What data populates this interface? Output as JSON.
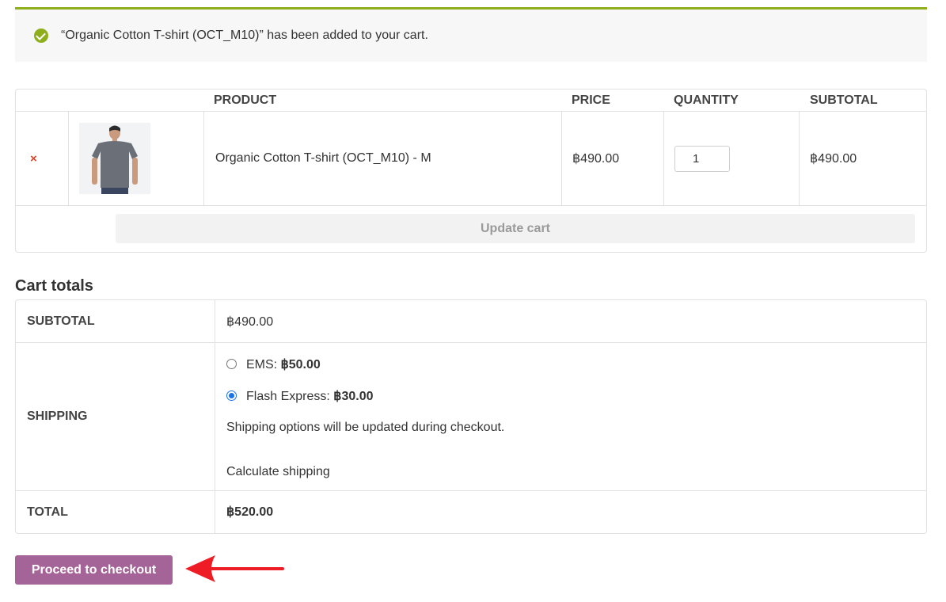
{
  "notice": {
    "message": "“Organic Cotton T-shirt (OCT_M10)” has been added to your cart."
  },
  "cart": {
    "headers": {
      "product": "PRODUCT",
      "price": "PRICE",
      "quantity": "QUANTITY",
      "subtotal": "SUBTOTAL"
    },
    "items": [
      {
        "remove": "×",
        "name": "Organic Cotton T-shirt (OCT_M10) - M",
        "price": "฿490.00",
        "quantity": "1",
        "subtotal": "฿490.00"
      }
    ],
    "update_label": "Update cart"
  },
  "totals": {
    "title": "Cart totals",
    "subtotal_label": "SUBTOTAL",
    "subtotal_value": "฿490.00",
    "shipping_label": "SHIPPING",
    "shipping_options": [
      {
        "name": "EMS: ",
        "price": "฿50.00",
        "selected": false
      },
      {
        "name": "Flash Express: ",
        "price": "฿30.00",
        "selected": true
      }
    ],
    "shipping_note": "Shipping options will be updated during checkout.",
    "calculate_label": "Calculate shipping",
    "total_label": "TOTAL",
    "total_value": "฿520.00"
  },
  "checkout": {
    "label": "Proceed to checkout"
  },
  "colors": {
    "accent_green": "#8fae1b",
    "checkout_purple": "#a46497",
    "remove_red": "#e2401c",
    "arrow_red": "#ee1c25"
  },
  "icons": {
    "notice": "check-circle-icon",
    "remove": "remove-x-icon",
    "annotation": "arrow-left-icon"
  }
}
